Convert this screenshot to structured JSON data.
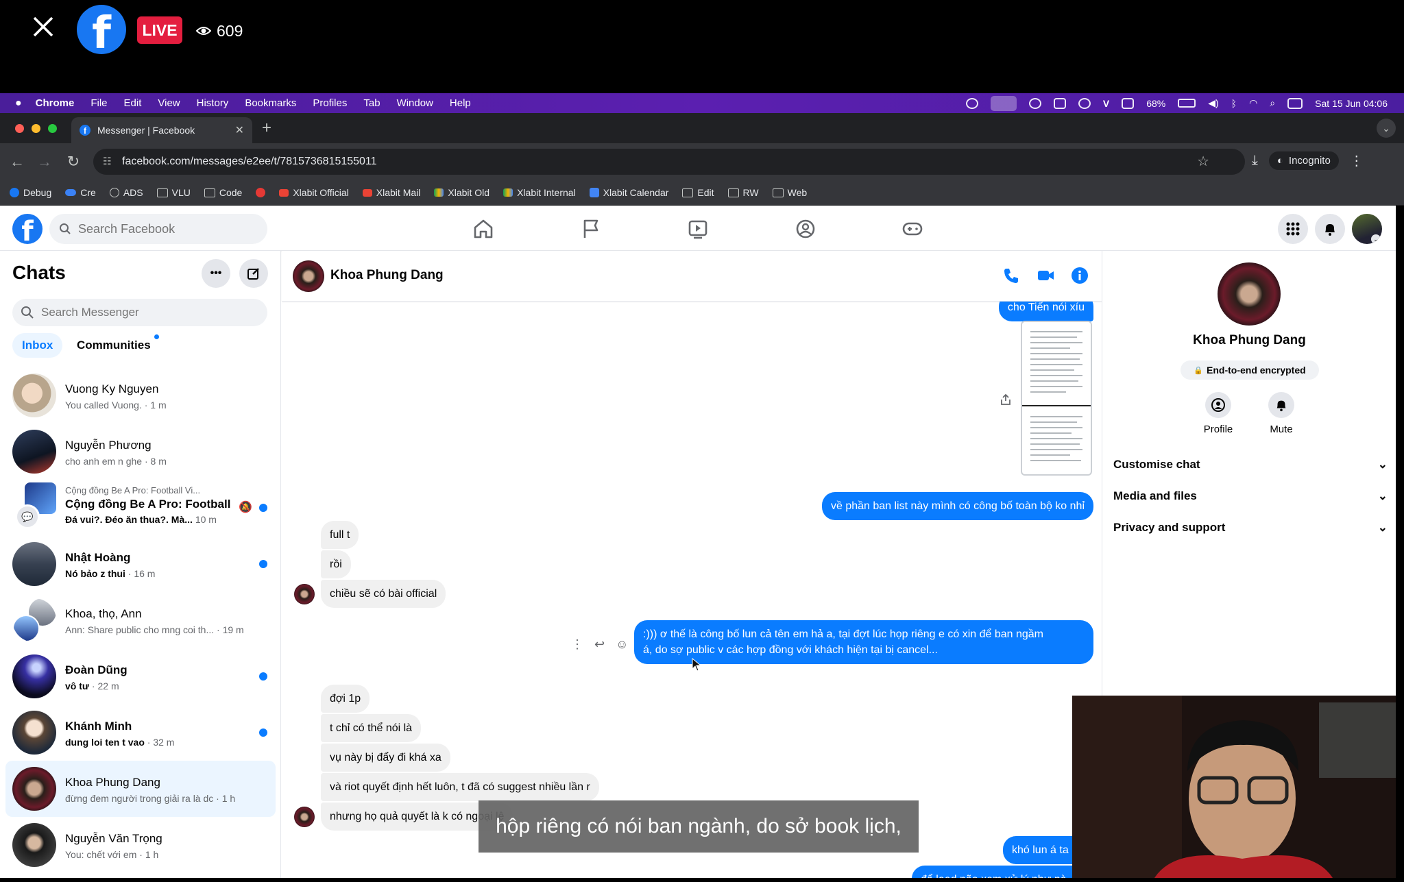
{
  "live": {
    "badge": "LIVE",
    "viewers": "609"
  },
  "menubar": {
    "items": [
      "Chrome",
      "File",
      "Edit",
      "View",
      "History",
      "Bookmarks",
      "Profiles",
      "Tab",
      "Window",
      "Help"
    ],
    "battery": "68%",
    "datetime": "Sat 15 Jun  04:06",
    "v_label": "V"
  },
  "browser": {
    "tab_title": "Messenger | Facebook",
    "url": "facebook.com/messages/e2ee/t/7815736815155011",
    "incognito": "Incognito",
    "bookmarks": [
      "Debug",
      "Cre",
      "ADS",
      "VLU",
      "Code",
      "",
      "Xlabit Official",
      "Xlabit Mail",
      "Xlabit Old",
      "Xlabit Internal",
      "Xlabit Calendar",
      "Edit",
      "RW",
      "Web"
    ]
  },
  "facebook": {
    "search_placeholder": "Search Facebook",
    "sidebar": {
      "title": "Chats",
      "search_placeholder": "Search Messenger",
      "filter_inbox": "Inbox",
      "filter_communities": "Communities",
      "chats": [
        {
          "name": "Vuong Ky Nguyen",
          "preview": "You called Vuong. · 1 m",
          "unread": false
        },
        {
          "name": "Nguyễn Phương",
          "preview": "cho anh em n ghe · 8 m",
          "unread": false
        },
        {
          "over": "Cộng đồng Be A Pro: Football Vi...",
          "name": "Cộng đồng Be A Pro: Football",
          "preview": "Đá vui?. Đéo ăn thua?. Mà...",
          "time": "10 m",
          "unread": true
        },
        {
          "name": "Nhật Hoàng",
          "preview": "Nó bảo z thui",
          "time": "16 m",
          "unread": true
        },
        {
          "name": "Khoa, thọ, Ann",
          "preview": "Ann: Share public cho mng coi th... · 19 m",
          "unread": false
        },
        {
          "name": "Đoàn Dũng",
          "preview": "vô tư",
          "time": "22 m",
          "unread": true
        },
        {
          "name": "Khánh Minh",
          "preview": "dung loi ten t vao",
          "time": "32 m",
          "unread": true
        },
        {
          "name": "Khoa Phung Dang",
          "preview": "đừng đem người trong giải ra là dc · 1 h",
          "unread": false
        },
        {
          "name": "Nguyễn Văn Trọng",
          "preview": "You: chết với em · 1 h",
          "unread": false
        }
      ]
    },
    "conversation": {
      "name": "Khoa Phung Dang",
      "messages": [
        {
          "text": "cho Tiến nói xíu",
          "dir": "out"
        },
        {
          "text": "về phần ban list này mình có công bố toàn bộ ko nhỉ",
          "dir": "out"
        },
        {
          "text": "full t",
          "dir": "in"
        },
        {
          "text": "rồi",
          "dir": "in"
        },
        {
          "text": "chiều sẽ có bài official",
          "dir": "in"
        },
        {
          "text": ":))) ơ thế là công bố lun cả tên em hả a, tại đợt lúc họp riêng e có xin để ban ngầm",
          "dir": "out"
        },
        {
          "text": "á, do sợ public v các hợp đồng với khách hiện tại bị cancel...",
          "dir": "out"
        },
        {
          "text": "đợi 1p",
          "dir": "in"
        },
        {
          "text": "t chỉ có thể nói là",
          "dir": "in"
        },
        {
          "text": "vụ này bị đẩy đi khá xa",
          "dir": "in"
        },
        {
          "text": "và riot quyết định hết luôn, t đã có suggest nhiều lần r",
          "dir": "in"
        },
        {
          "text": "nhưng họ quả quyết là k có ngoại lệ",
          "dir": "in"
        },
        {
          "text": "khó lun á ta",
          "dir": "out"
        },
        {
          "text": "để load não xem xử lý như nà",
          "dir": "out"
        }
      ]
    },
    "info_panel": {
      "name": "Khoa Phung Dang",
      "encrypted": "End-to-end encrypted",
      "profile_label": "Profile",
      "mute_label": "Mute",
      "sections": [
        "Customise chat",
        "Media and files",
        "Privacy and support"
      ]
    }
  },
  "caption": "hộp riêng có nói ban ngành, do sở book lịch,"
}
